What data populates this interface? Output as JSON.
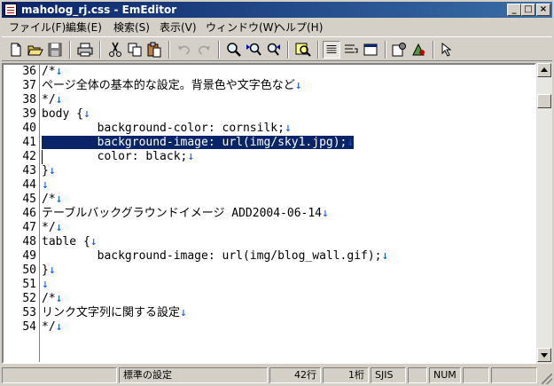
{
  "window": {
    "title": "maholog_rj.css - EmEditor"
  },
  "menu": [
    {
      "label": "ファイル(F)"
    },
    {
      "label": "編集(E)"
    },
    {
      "label": "検索(S)"
    },
    {
      "label": "表示(V)"
    },
    {
      "label": "ウィンドウ(W)"
    },
    {
      "label": "ヘルプ(H)"
    }
  ],
  "toolbar_icons": [
    "new-file",
    "open-folder",
    "save",
    "print",
    "cut",
    "copy",
    "paste",
    "undo",
    "redo",
    "find",
    "find-next",
    "find-prev",
    "highlight",
    "wrap-none",
    "wrap-window",
    "wrap-margin",
    "properties",
    "macro",
    "select-tool"
  ],
  "editor": {
    "lines": [
      {
        "num": "36",
        "text": "/*"
      },
      {
        "num": "37",
        "text": "ページ全体の基本的な設定。背景色や文字色など"
      },
      {
        "num": "38",
        "text": "*/"
      },
      {
        "num": "39",
        "text": "body {"
      },
      {
        "num": "40",
        "text": "        background-color: cornsilk;"
      },
      {
        "num": "41",
        "text": "        background-image: url(img/sky1.jpg);"
      },
      {
        "num": "42",
        "text": "        color: black;"
      },
      {
        "num": "43",
        "text": "}"
      },
      {
        "num": "44",
        "text": ""
      },
      {
        "num": "45",
        "text": "/*"
      },
      {
        "num": "46",
        "text": "テーブルバックグラウンドイメージ ADD2004-06-14"
      },
      {
        "num": "47",
        "text": "*/"
      },
      {
        "num": "48",
        "text": "table {"
      },
      {
        "num": "49",
        "text": "        background-image: url(img/blog_wall.gif);"
      },
      {
        "num": "50",
        "text": "}"
      },
      {
        "num": "51",
        "text": ""
      },
      {
        "num": "52",
        "text": "/*"
      },
      {
        "num": "53",
        "text": "リンク文字列に関する設定"
      },
      {
        "num": "54",
        "text": "*/"
      }
    ],
    "newline_glyph": "↓",
    "selected_line": "41"
  },
  "status": {
    "config": "標準の設定",
    "line": "42行",
    "column": "1桁",
    "encoding": "SJIS",
    "num": "NUM"
  },
  "colors": {
    "titlebar": "#0a246a",
    "selection": "#0a246a",
    "newline": "#0050ff"
  }
}
